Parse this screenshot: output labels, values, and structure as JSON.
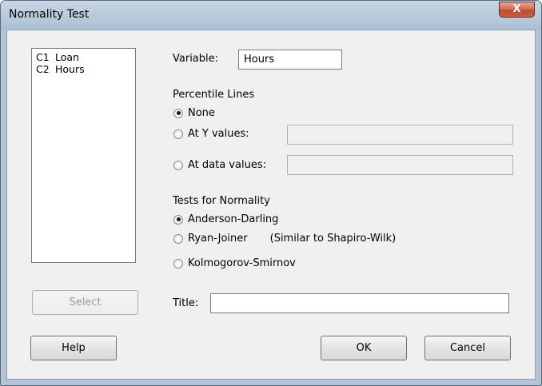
{
  "window": {
    "title": "Normality Test",
    "close_glyph": "X"
  },
  "variables_list": [
    {
      "id": "C1",
      "name": "Loan"
    },
    {
      "id": "C2",
      "name": "Hours"
    }
  ],
  "select_button": "Select",
  "variable": {
    "label": "Variable:",
    "value": "Hours"
  },
  "percentile_lines": {
    "heading": "Percentile Lines",
    "none_label": "None",
    "at_y_label": "At Y values:",
    "at_data_label": "At data values:",
    "at_y_value": "",
    "at_data_value": "",
    "selected": "None"
  },
  "tests": {
    "heading": "Tests for Normality",
    "anderson_label": "Anderson-Darling",
    "ryan_label": "Ryan-Joiner",
    "ryan_note": "(Similar to Shapiro-Wilk)",
    "kolmogorov_label": "Kolmogorov-Smirnov",
    "selected": "Anderson-Darling"
  },
  "title_field": {
    "label": "Title:",
    "value": ""
  },
  "buttons": {
    "help": "Help",
    "ok": "OK",
    "cancel": "Cancel"
  }
}
